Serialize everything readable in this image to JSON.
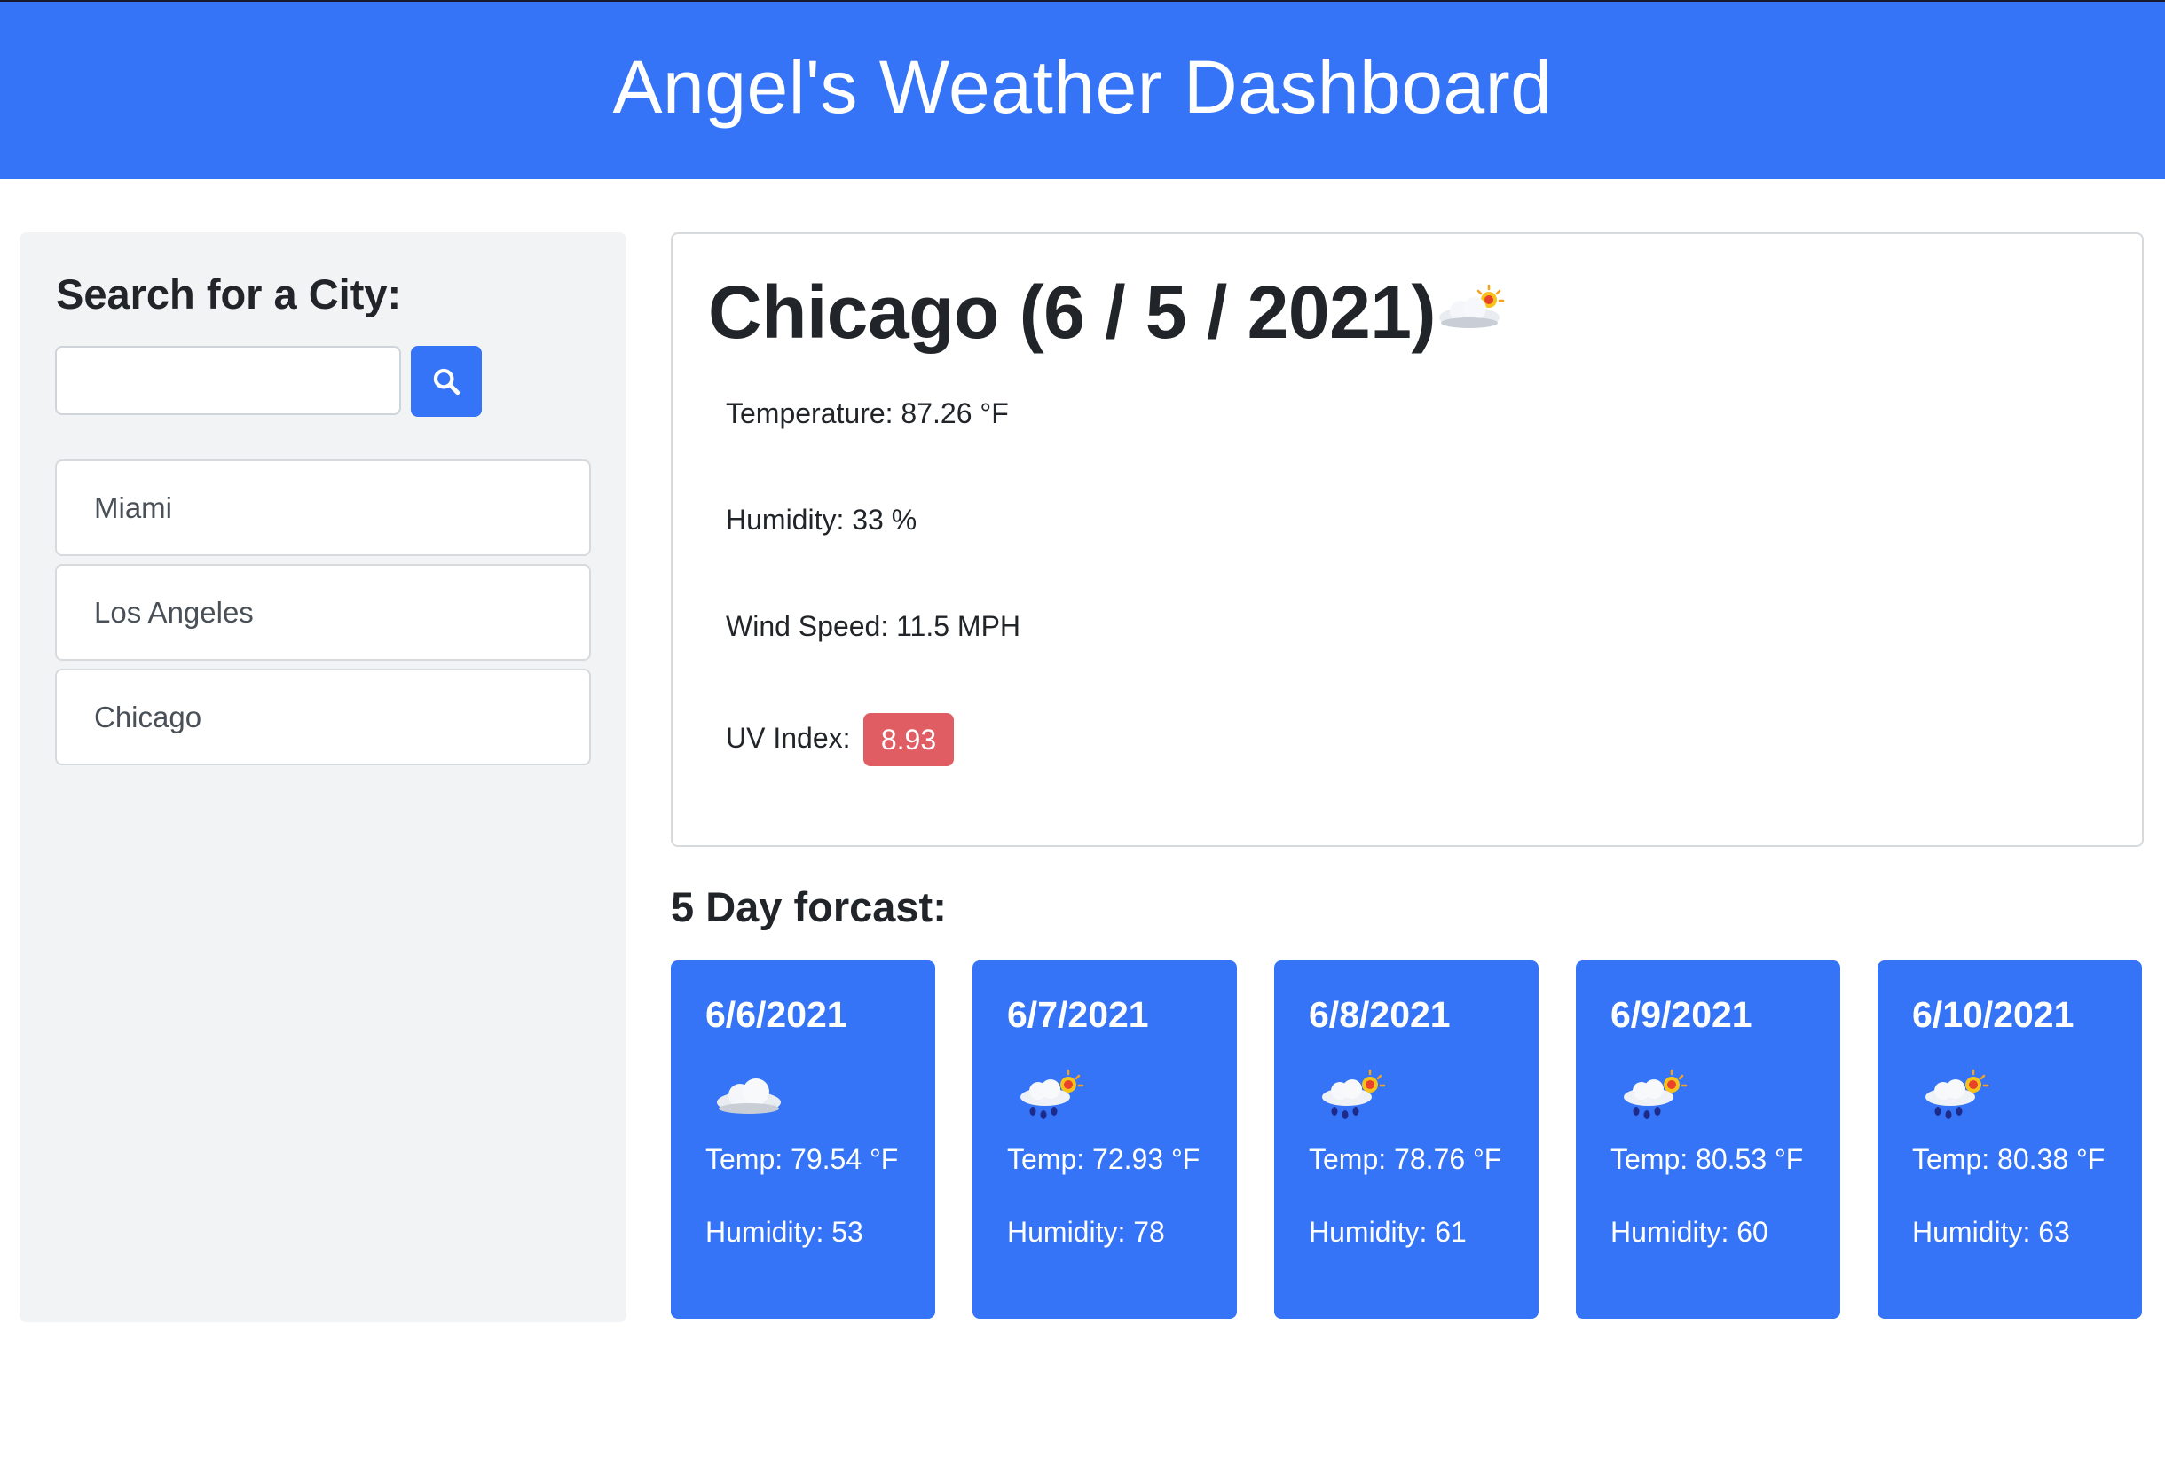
{
  "header": {
    "title": "Angel's Weather Dashboard"
  },
  "colors": {
    "brand": "#3574f6",
    "uv_badge": "#e05d63",
    "sidebar_bg": "#f2f3f5"
  },
  "sidebar": {
    "heading": "Search for a City:",
    "search": {
      "value": "",
      "placeholder": "",
      "button_icon": "search-icon"
    },
    "history": [
      "Miami",
      "Los Angeles",
      "Chicago"
    ]
  },
  "current": {
    "title": "Chicago (6 / 5 / 2021)",
    "icon": "cloud-sun-icon",
    "temperature": "Temperature: 87.26 °F",
    "humidity": "Humidity: 33 %",
    "wind": "Wind Speed: 11.5 MPH",
    "uv_label": "UV Index:",
    "uv_value": "8.93"
  },
  "forecast": {
    "heading": "5 Day forcast:",
    "days": [
      {
        "date": "6/6/2021",
        "icon": "cloud-icon",
        "temp": "Temp: 79.54 °F",
        "humidity": "Humidity: 53"
      },
      {
        "date": "6/7/2021",
        "icon": "rain-sun-icon",
        "temp": "Temp: 72.93 °F",
        "humidity": "Humidity: 78"
      },
      {
        "date": "6/8/2021",
        "icon": "rain-sun-icon",
        "temp": "Temp: 78.76 °F",
        "humidity": "Humidity: 61"
      },
      {
        "date": "6/9/2021",
        "icon": "rain-sun-icon",
        "temp": "Temp: 80.53 °F",
        "humidity": "Humidity: 60"
      },
      {
        "date": "6/10/2021",
        "icon": "rain-sun-icon",
        "temp": "Temp: 80.38 °F",
        "humidity": "Humidity: 63"
      }
    ]
  }
}
